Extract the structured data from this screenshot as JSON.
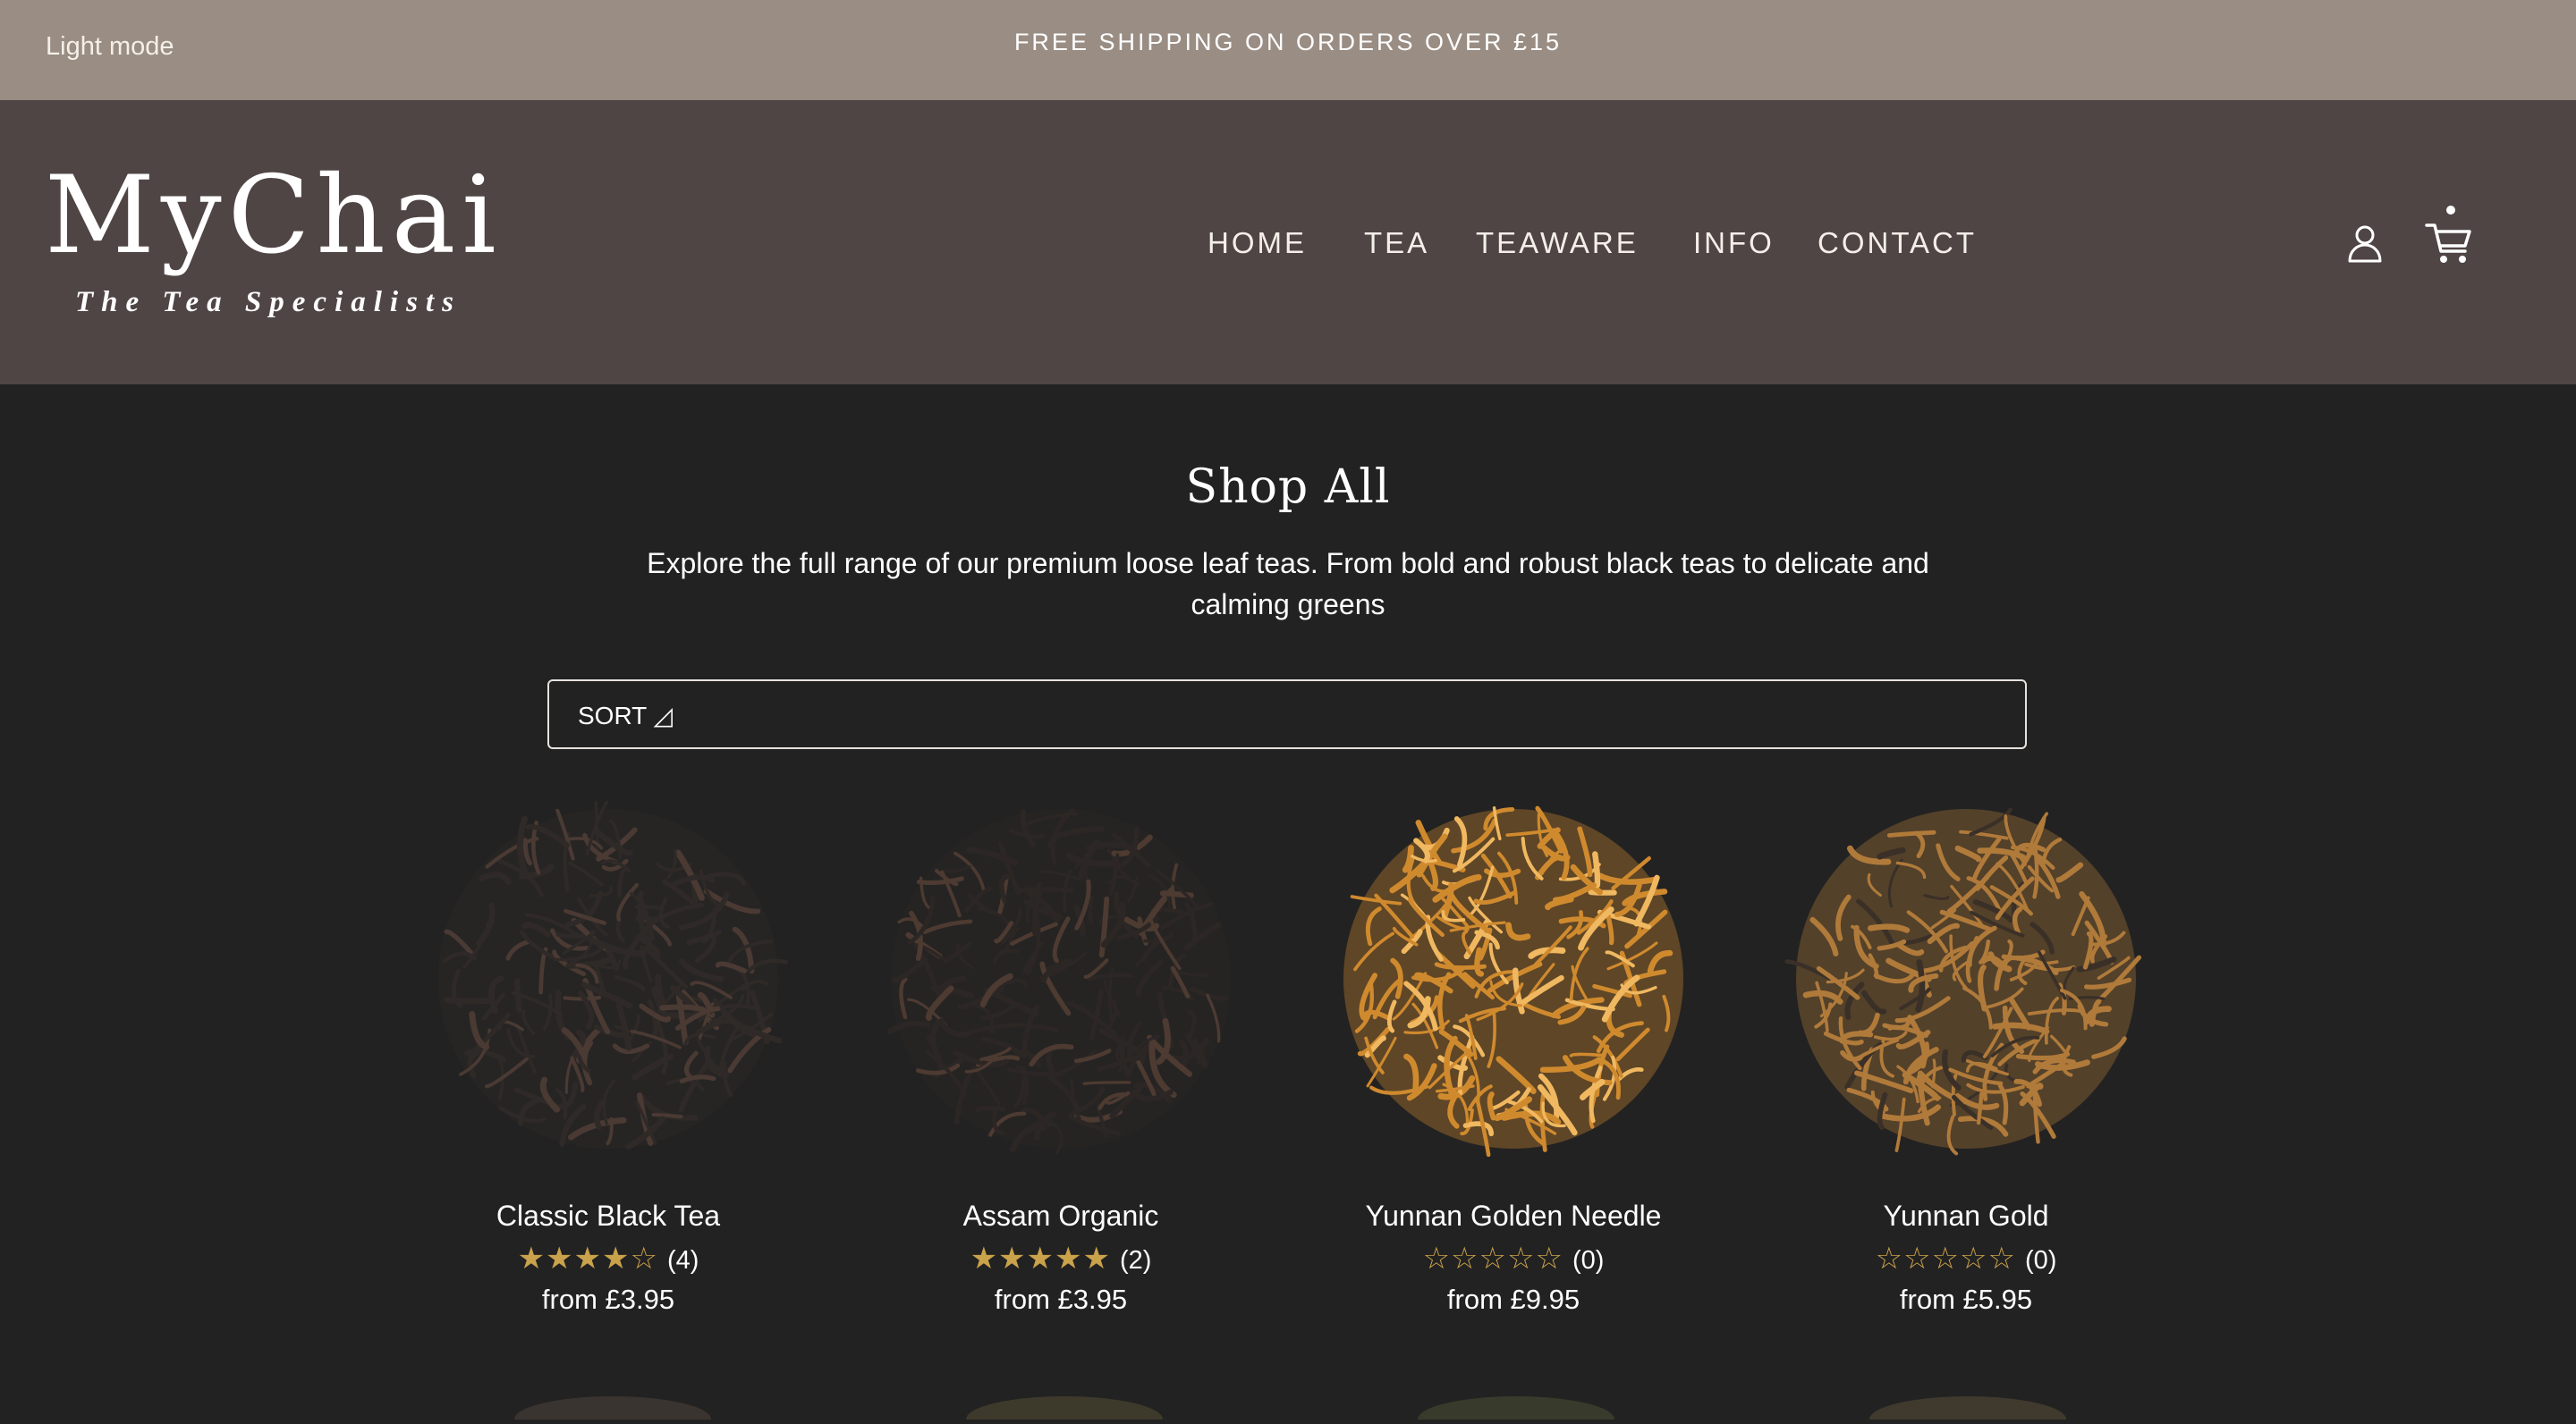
{
  "topbar": {
    "mode_toggle": "Light mode",
    "promo": "FREE SHIPPING ON ORDERS OVER £15"
  },
  "header": {
    "logo_main": "MyChai",
    "logo_tagline": "The Tea Specialists",
    "nav": [
      "HOME",
      "TEA",
      "TEAWARE",
      "INFO",
      "CONTACT"
    ],
    "icons": [
      "account-icon",
      "cart-icon"
    ]
  },
  "main": {
    "title": "Shop All",
    "intro": "Explore the full range of our premium loose leaf teas. From bold and robust black teas to delicate and calming greens",
    "sort_label": "SORT ◿",
    "products": [
      {
        "name": "Classic Black Tea",
        "stars": "★★★★☆",
        "rating": 4,
        "count": "(4)",
        "price": "from £3.95",
        "leaf_color": "#2f2a27",
        "leaf_accent": "#4a3a33"
      },
      {
        "name": "Assam Organic",
        "stars": "★★★★★",
        "rating": 5,
        "count": "(2)",
        "price": "from £3.95",
        "leaf_color": "#2c2725",
        "leaf_accent": "#4d3a31"
      },
      {
        "name": "Yunnan Golden Needle",
        "stars": "☆☆☆☆☆",
        "rating": 0,
        "count": "(0)",
        "price": "from £9.95",
        "leaf_color": "#d08a2e",
        "leaf_accent": "#f0b860"
      },
      {
        "name": "Yunnan Gold",
        "stars": "☆☆☆☆☆",
        "rating": 0,
        "count": "(0)",
        "price": "from £5.95",
        "leaf_color": "#b07a3a",
        "leaf_accent": "#3a3028"
      }
    ]
  },
  "colors": {
    "topbar_bg": "#9a8d84",
    "header_bg": "#4f4544",
    "page_bg": "#232222",
    "star_gold": "#c9a24b"
  }
}
